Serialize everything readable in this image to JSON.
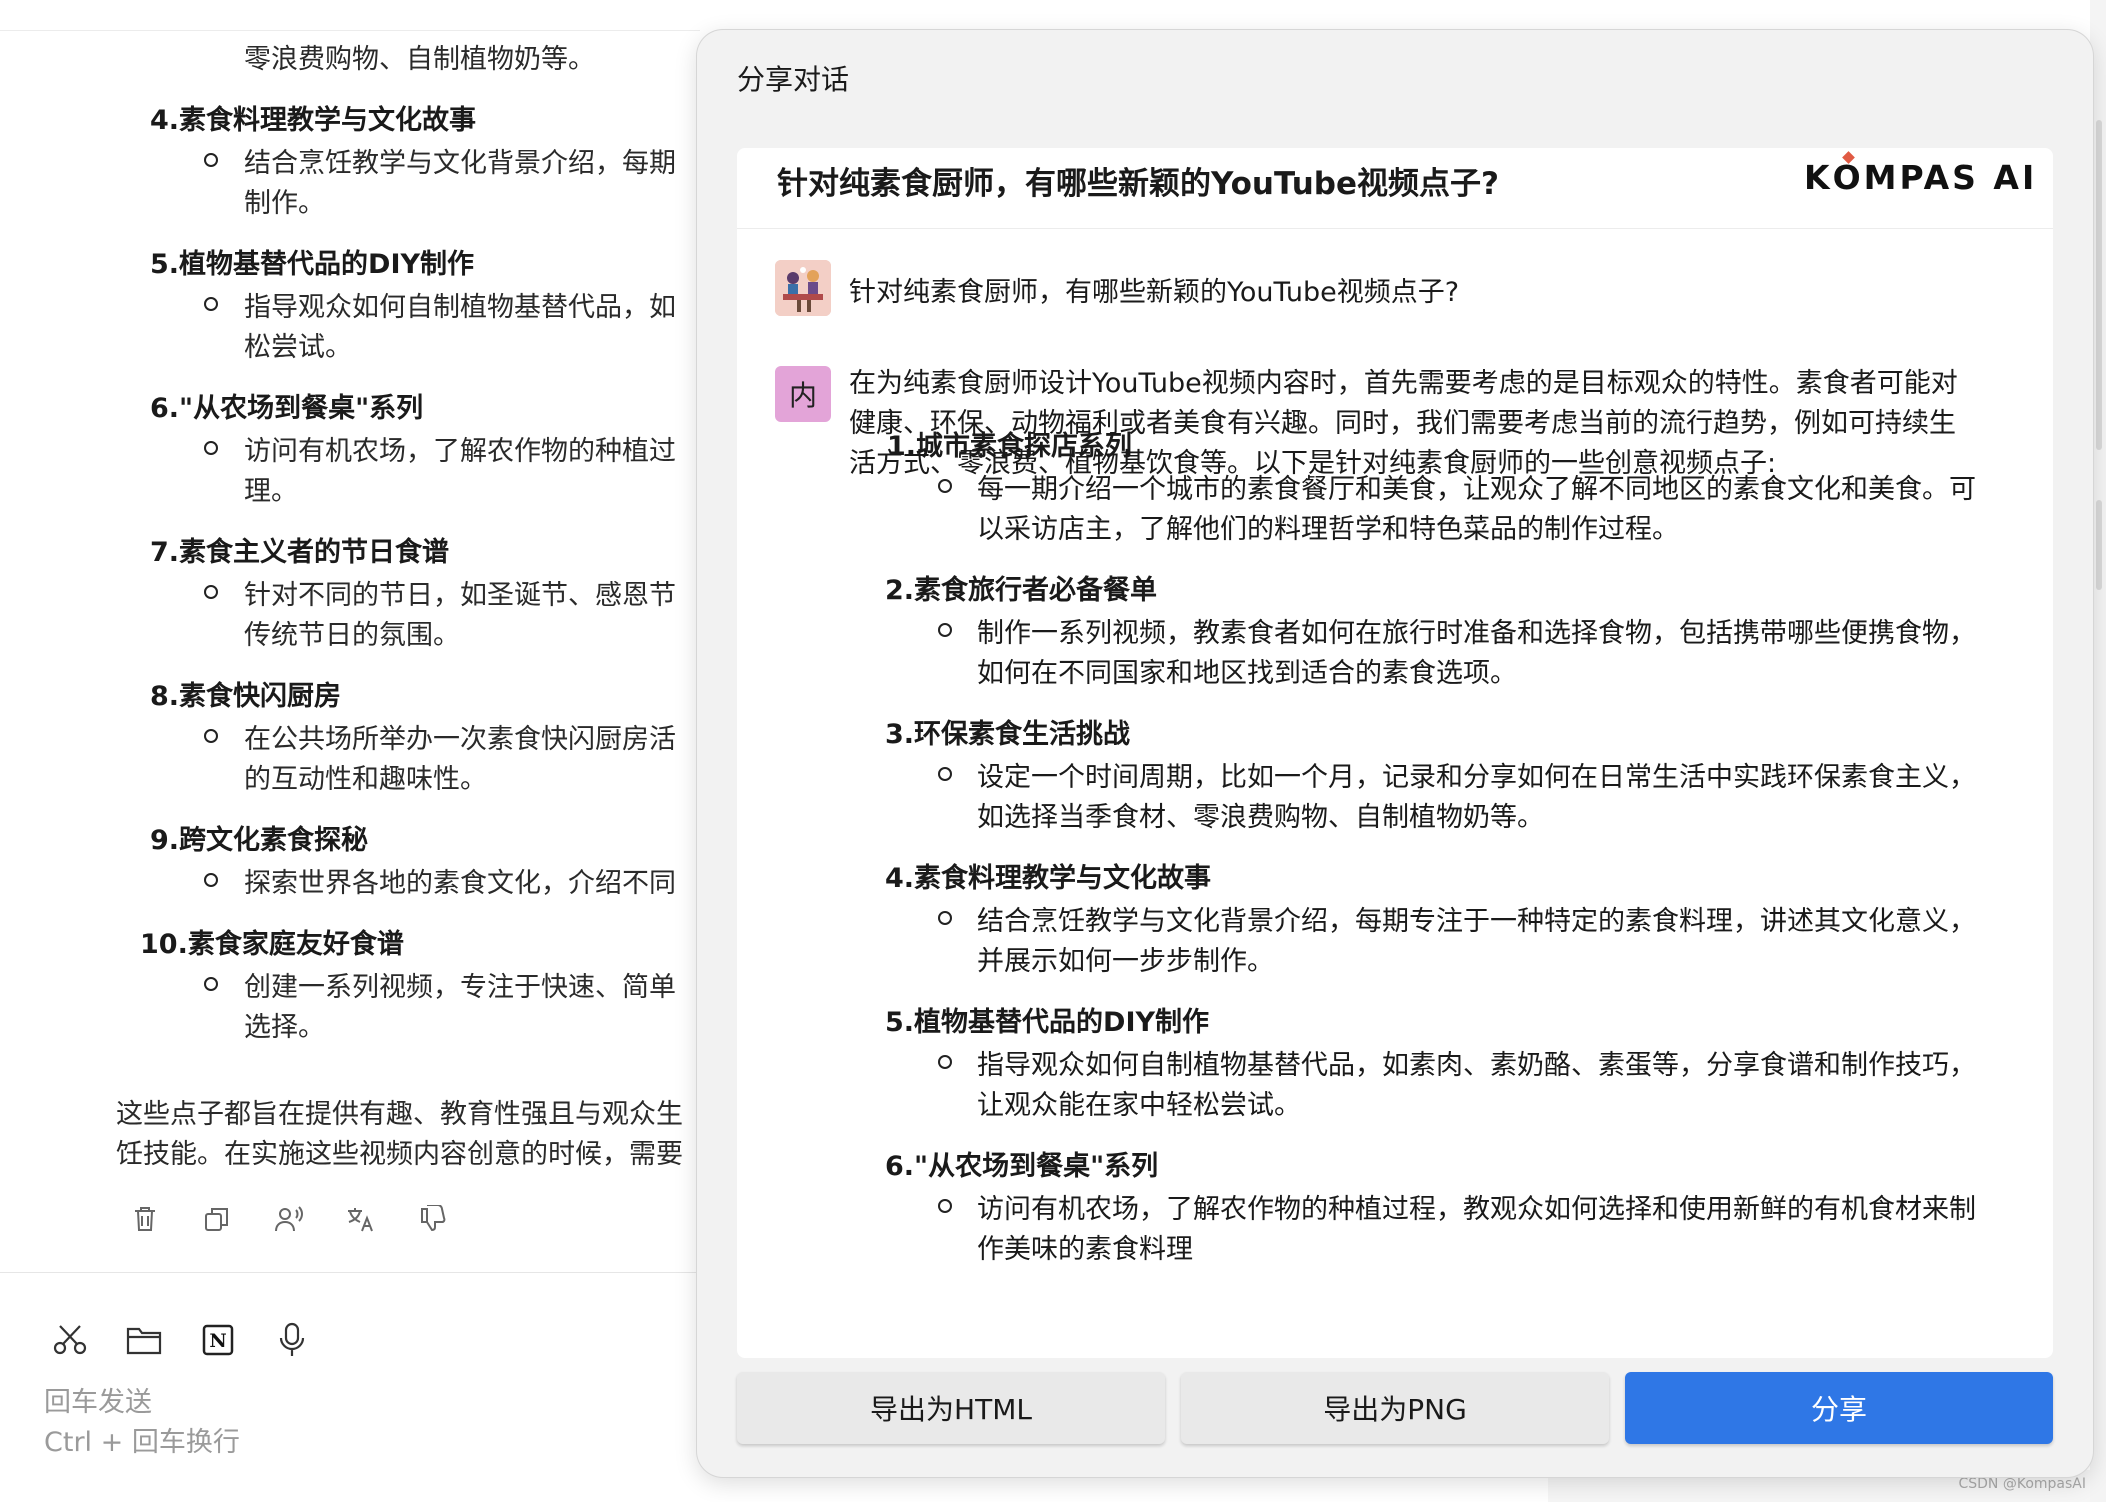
{
  "background_chat": {
    "cut_top_text": "零浪费购物、自制植物奶等。",
    "items": [
      {
        "num": "4.",
        "title": "素食料理教学与文化故事",
        "body": "结合烹饪教学与文化背景介绍，每期\n制作。"
      },
      {
        "num": "5.",
        "title": "植物基替代品的DIY制作",
        "body": "指导观众如何自制植物基替代品，如\n松尝试。"
      },
      {
        "num": "6.",
        "title": "\"从农场到餐桌\"系列",
        "body": "访问有机农场，了解农作物的种植过\n理。"
      },
      {
        "num": "7.",
        "title": "素食主义者的节日食谱",
        "body": "针对不同的节日，如圣诞节、感恩节\n传统节日的氛围。"
      },
      {
        "num": "8.",
        "title": "素食快闪厨房",
        "body": "在公共场所举办一次素食快闪厨房活\n的互动性和趣味性。"
      },
      {
        "num": "9.",
        "title": "跨文化素食探秘",
        "body": "探索世界各地的素食文化，介绍不同"
      },
      {
        "num": "10.",
        "title": "素食家庭友好食谱",
        "body": "创建一系列视频，专注于快速、简单\n选择。"
      }
    ],
    "summary": "这些点子都旨在提供有趣、教育性强且与观众生\n饪技能。在实施这些视频内容创意的时候，需要",
    "input_hint_line1": "回车发送",
    "input_hint_line2": "Ctrl + 回车换行",
    "message_action_icons": [
      "trash-icon",
      "copy-icon",
      "read-aloud-icon",
      "translate-icon",
      "thumbs-down-icon"
    ],
    "input_tool_icons": [
      "scissors-icon",
      "folder-icon",
      "notion-icon",
      "microphone-icon"
    ]
  },
  "modal": {
    "title": "分享对话",
    "card_title": "针对纯素食厨师，有哪些新颖的YouTube视频点子?",
    "brand_pre": "K",
    "brand_o": "O",
    "brand_post": "MPAS AI",
    "user_message": "针对纯素食厨师，有哪些新颖的YouTube视频点子?",
    "ai_avatar_char": "内",
    "ai_intro": "在为纯素食厨师设计YouTube视频内容时，首先需要考虑的是目标观众的特性。素食者可能对\n健康、环保、动物福利或者美食有兴趣。同时，我们需要考虑当前的流行趋势，例如可持续生\n活方式、零浪费、植物基饮食等。以下是针对纯素食厨师的一些创意视频点子:",
    "ai_items": [
      {
        "num": "1.",
        "title": "城市素食探店系列",
        "body": "每一期介绍一个城市的素食餐厅和美食，让观众了解不同地区的素食文化和美食。可\n以采访店主，了解他们的料理哲学和特色菜品的制作过程。"
      },
      {
        "num": "2.",
        "title": "素食旅行者必备餐单",
        "body": "制作一系列视频，教素食者如何在旅行时准备和选择食物，包括携带哪些便携食物，\n如何在不同国家和地区找到适合的素食选项。"
      },
      {
        "num": "3.",
        "title": "环保素食生活挑战",
        "body": "设定一个时间周期，比如一个月，记录和分享如何在日常生活中实践环保素食主义，\n如选择当季食材、零浪费购物、自制植物奶等。"
      },
      {
        "num": "4.",
        "title": "素食料理教学与文化故事",
        "body": "结合烹饪教学与文化背景介绍，每期专注于一种特定的素食料理，讲述其文化意义，\n并展示如何一步步制作。"
      },
      {
        "num": "5.",
        "title": "植物基替代品的DIY制作",
        "body": "指导观众如何自制植物基替代品，如素肉、素奶酪、素蛋等，分享食谱和制作技巧，\n让观众能在家中轻松尝试。"
      },
      {
        "num": "6.",
        "title": "\"从农场到餐桌\"系列",
        "body": "访问有机农场，了解农作物的种植过程，教观众如何选择和使用新鲜的有机食材来制\n作美味的素食料理"
      }
    ],
    "buttons": {
      "export_html": "导出为HTML",
      "export_png": "导出为PNG",
      "share": "分享"
    }
  },
  "watermark": "CSDN @KompasAI",
  "colors": {
    "primary_button": "#2f77e6",
    "ai_avatar_bg": "#e3a4d8",
    "brand_accent": "#e05a43"
  }
}
